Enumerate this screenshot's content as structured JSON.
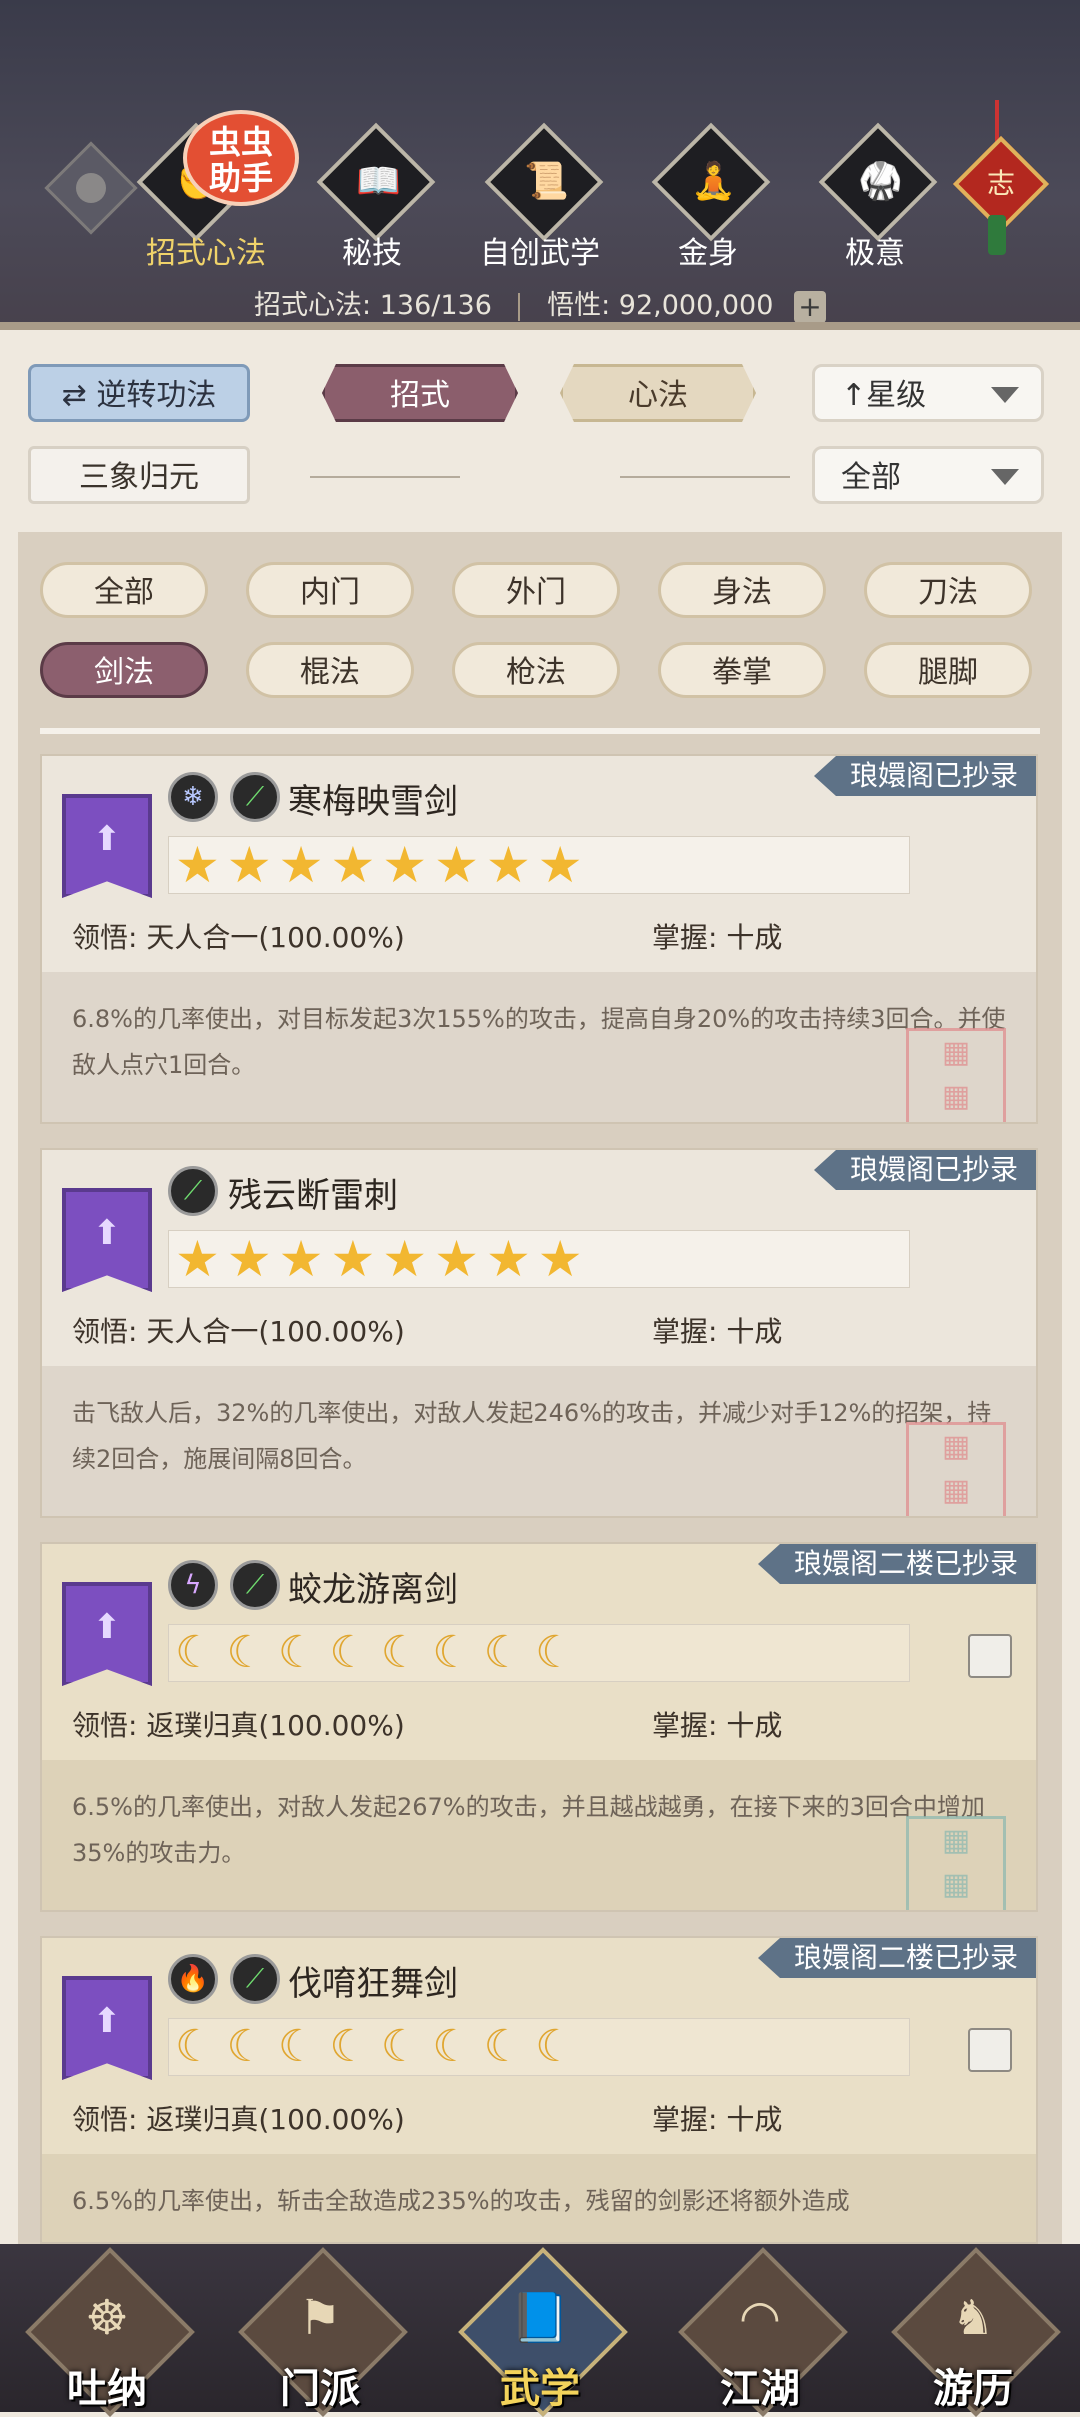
{
  "top_tabs": [
    {
      "label": "招式心法",
      "icon": "fist-icon",
      "active": true
    },
    {
      "label": "秘技",
      "icon": "book-icon",
      "active": false
    },
    {
      "label": "自创武学",
      "icon": "scroll-icon",
      "active": false
    },
    {
      "label": "金身",
      "icon": "meditation-icon",
      "active": false
    },
    {
      "label": "极意",
      "icon": "martial-pose-icon",
      "active": false
    }
  ],
  "helper_badge": {
    "line1": "虫虫",
    "line2": "助手"
  },
  "charm": {
    "text": "志"
  },
  "stats": {
    "moves_label": "招式心法:",
    "moves_value": "136/136",
    "insight_label": "悟性:",
    "insight_value": "92,000,000",
    "plus": "+"
  },
  "filters": {
    "reverse_button": "逆转功法",
    "reverse_icon": "⇄",
    "tab_moves": "招式",
    "tab_mental": "心法",
    "sort_select": "星级",
    "sort_arrow": "↑",
    "sanxiang_button": "三象归元",
    "range_select": "全部"
  },
  "categories": [
    {
      "label": "全部",
      "active": false
    },
    {
      "label": "内门",
      "active": false
    },
    {
      "label": "外门",
      "active": false
    },
    {
      "label": "身法",
      "active": false
    },
    {
      "label": "刀法",
      "active": false
    },
    {
      "label": "剑法",
      "active": true
    },
    {
      "label": "棍法",
      "active": false
    },
    {
      "label": "枪法",
      "active": false
    },
    {
      "label": "拳掌",
      "active": false
    },
    {
      "label": "腿脚",
      "active": false
    }
  ],
  "skills": [
    {
      "badge": "琅嬛阁已抄录",
      "name": "寒梅映雪剑",
      "icons": [
        "snowflake-icon",
        "sword-slash-icon"
      ],
      "stars": "★★★★★★★★",
      "star_count": 8,
      "rank_type": "star",
      "comprehension_label": "领悟:",
      "comprehension_value": "天人合一(100.00%)",
      "mastery_label": "掌握:",
      "mastery_value": "十成",
      "description": "6.8%的几率使出，对目标发起3次155%的攻击，提高自身20%的攻击持续3回合。并使敌人点穴1回合。"
    },
    {
      "badge": "琅嬛阁已抄录",
      "name": "残云断雷刺",
      "icons": [
        "sword-slash-icon"
      ],
      "stars": "★★★★★★★★",
      "star_count": 8,
      "rank_type": "star",
      "comprehension_label": "领悟:",
      "comprehension_value": "天人合一(100.00%)",
      "mastery_label": "掌握:",
      "mastery_value": "十成",
      "description": "击飞敌人后，32%的几率使出，对敌人发起246%的攻击，并减少对手12%的招架，持续2回合，施展间隔8回合。"
    },
    {
      "badge": "琅嬛阁二楼已抄录",
      "name": "蛟龙游离剑",
      "icons": [
        "lightning-icon",
        "sword-slash-icon"
      ],
      "stars": "☾☾☾☾☾☾☾☾",
      "star_count": 8,
      "rank_type": "moon",
      "comprehension_label": "领悟:",
      "comprehension_value": "返璞归真(100.00%)",
      "mastery_label": "掌握:",
      "mastery_value": "十成",
      "description": "6.5%的几率使出，对敌人发起267%的攻击，并且越战越勇，在接下来的3回合中增加35%的攻击力。"
    },
    {
      "badge": "琅嬛阁二楼已抄录",
      "name": "伐唷狂舞剑",
      "icons": [
        "fire-icon",
        "sword-slash-icon"
      ],
      "stars": "☾☾☾☾☾☾☾☾",
      "star_count": 8,
      "rank_type": "moon",
      "comprehension_label": "领悟:",
      "comprehension_value": "返璞归真(100.00%)",
      "mastery_label": "掌握:",
      "mastery_value": "十成",
      "description": "6.5%的几率使出，斩击全敌造成235%的攻击，残留的剑影还将额外造成"
    }
  ],
  "bottom_nav": [
    {
      "label": "吐纳",
      "icon": "monk-icon",
      "active": false
    },
    {
      "label": "门派",
      "icon": "sect-flags-icon",
      "active": false
    },
    {
      "label": "武学",
      "icon": "manual-books-icon",
      "active": true
    },
    {
      "label": "江湖",
      "icon": "straw-hat-icon",
      "active": false
    },
    {
      "label": "游历",
      "icon": "horse-icon",
      "active": false
    }
  ],
  "colors": {
    "accent_purple": "#8c5f6e",
    "badge_blue": "#5e7287",
    "star_gold": "#f2b731"
  }
}
